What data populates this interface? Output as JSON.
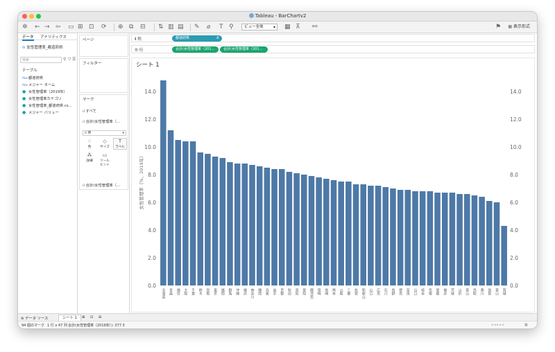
{
  "window": {
    "title": "Tableau - BarChartv2"
  },
  "toolbar": {
    "view_select": "ビュー全体",
    "show_me": "表示形式"
  },
  "left_pane": {
    "tab_data": "データ",
    "tab_analytics": "アナリティクス",
    "datasource": "女性管理率_都道府県",
    "search_placeholder": "検索",
    "section_tables": "テーブル",
    "fields": [
      {
        "type": "Abc",
        "name": "都道府県",
        "kind": "dim"
      },
      {
        "type": "Abc",
        "name": "メジャー ネーム",
        "kind": "dim"
      },
      {
        "type": "#",
        "name": "女性管理率（2019年）",
        "kind": "measure"
      },
      {
        "type": "#",
        "name": "女性管理率カテゴリ",
        "kind": "measure"
      },
      {
        "type": "#",
        "name": "女性管理率_都道府県.cs...",
        "kind": "measure"
      },
      {
        "type": "#",
        "name": "メジャー バリュー",
        "kind": "measure"
      }
    ]
  },
  "cards": {
    "pages": "ページ",
    "filters": "フィルター",
    "marks": "マーク",
    "marks_all": "すべて",
    "marks_sum": "合計(女性管理率（...",
    "mark_type": "棒",
    "btn_color": "色",
    "btn_size": "サイズ",
    "btn_label": "ラベル",
    "btn_detail": "詳細",
    "btn_tooltip": "ツールヒント",
    "marks_sum2": "合計(女性管理率（..."
  },
  "shelves": {
    "columns_label": "列",
    "rows_label": "行",
    "columns_pill": "都道府県",
    "rows_pill1": "合計(女性管理率（201...",
    "rows_pill2": "合計(女性管理率（201..."
  },
  "sheet": {
    "title": "シート 1"
  },
  "bottom_tabs": {
    "datasource": "データ ソース",
    "sheet1": "シート 1"
  },
  "status": {
    "marks": "94 個のマーク",
    "rowscols": "1 行 x 47 列",
    "sum": "合計(女性管理率（2019年）): 377.3"
  },
  "colors": {
    "bar": "#4e79a7",
    "pill_blue": "#2b9cb3",
    "pill_green": "#1aa56f"
  },
  "chart_data": {
    "type": "bar",
    "ylabel": "女性管理率（%、2019年）",
    "ylim": [
      0,
      15
    ],
    "yticks": [
      0.0,
      2.0,
      4.0,
      6.0,
      8.0,
      10.0,
      12.0,
      14.0
    ],
    "grid": false,
    "categories": [
      "北海道",
      "青森",
      "福島",
      "大阪",
      "千葉",
      "栃木",
      "鳥取",
      "東京",
      "福岡",
      "群馬",
      "沖縄",
      "福井",
      "神奈川",
      "静岡",
      "兵庫",
      "岩手",
      "京都",
      "秋田",
      "高知",
      "愛知",
      "鹿児島",
      "宮崎",
      "長崎",
      "熊本",
      "山梨",
      "三重",
      "佐賀",
      "和歌山",
      "山口",
      "広島",
      "石川",
      "長野",
      "徳島",
      "奈良",
      "山口",
      "岐阜",
      "島根",
      "愛媛",
      "福井",
      "茨城",
      "山形",
      "富山",
      "鳥取",
      "香川",
      "滋賀",
      "富山",
      "宮城"
    ],
    "values": [
      14.8,
      11.2,
      10.5,
      10.4,
      10.4,
      9.6,
      9.5,
      9.3,
      9.2,
      8.9,
      8.8,
      8.8,
      8.7,
      8.6,
      8.5,
      8.4,
      8.4,
      8.2,
      8.1,
      8.0,
      7.9,
      7.8,
      7.7,
      7.6,
      7.5,
      7.5,
      7.3,
      7.3,
      7.2,
      7.2,
      7.1,
      7.0,
      6.9,
      6.9,
      6.8,
      6.8,
      6.8,
      6.7,
      6.7,
      6.7,
      6.6,
      6.6,
      6.5,
      6.4,
      6.1,
      6.0,
      4.3
    ]
  }
}
